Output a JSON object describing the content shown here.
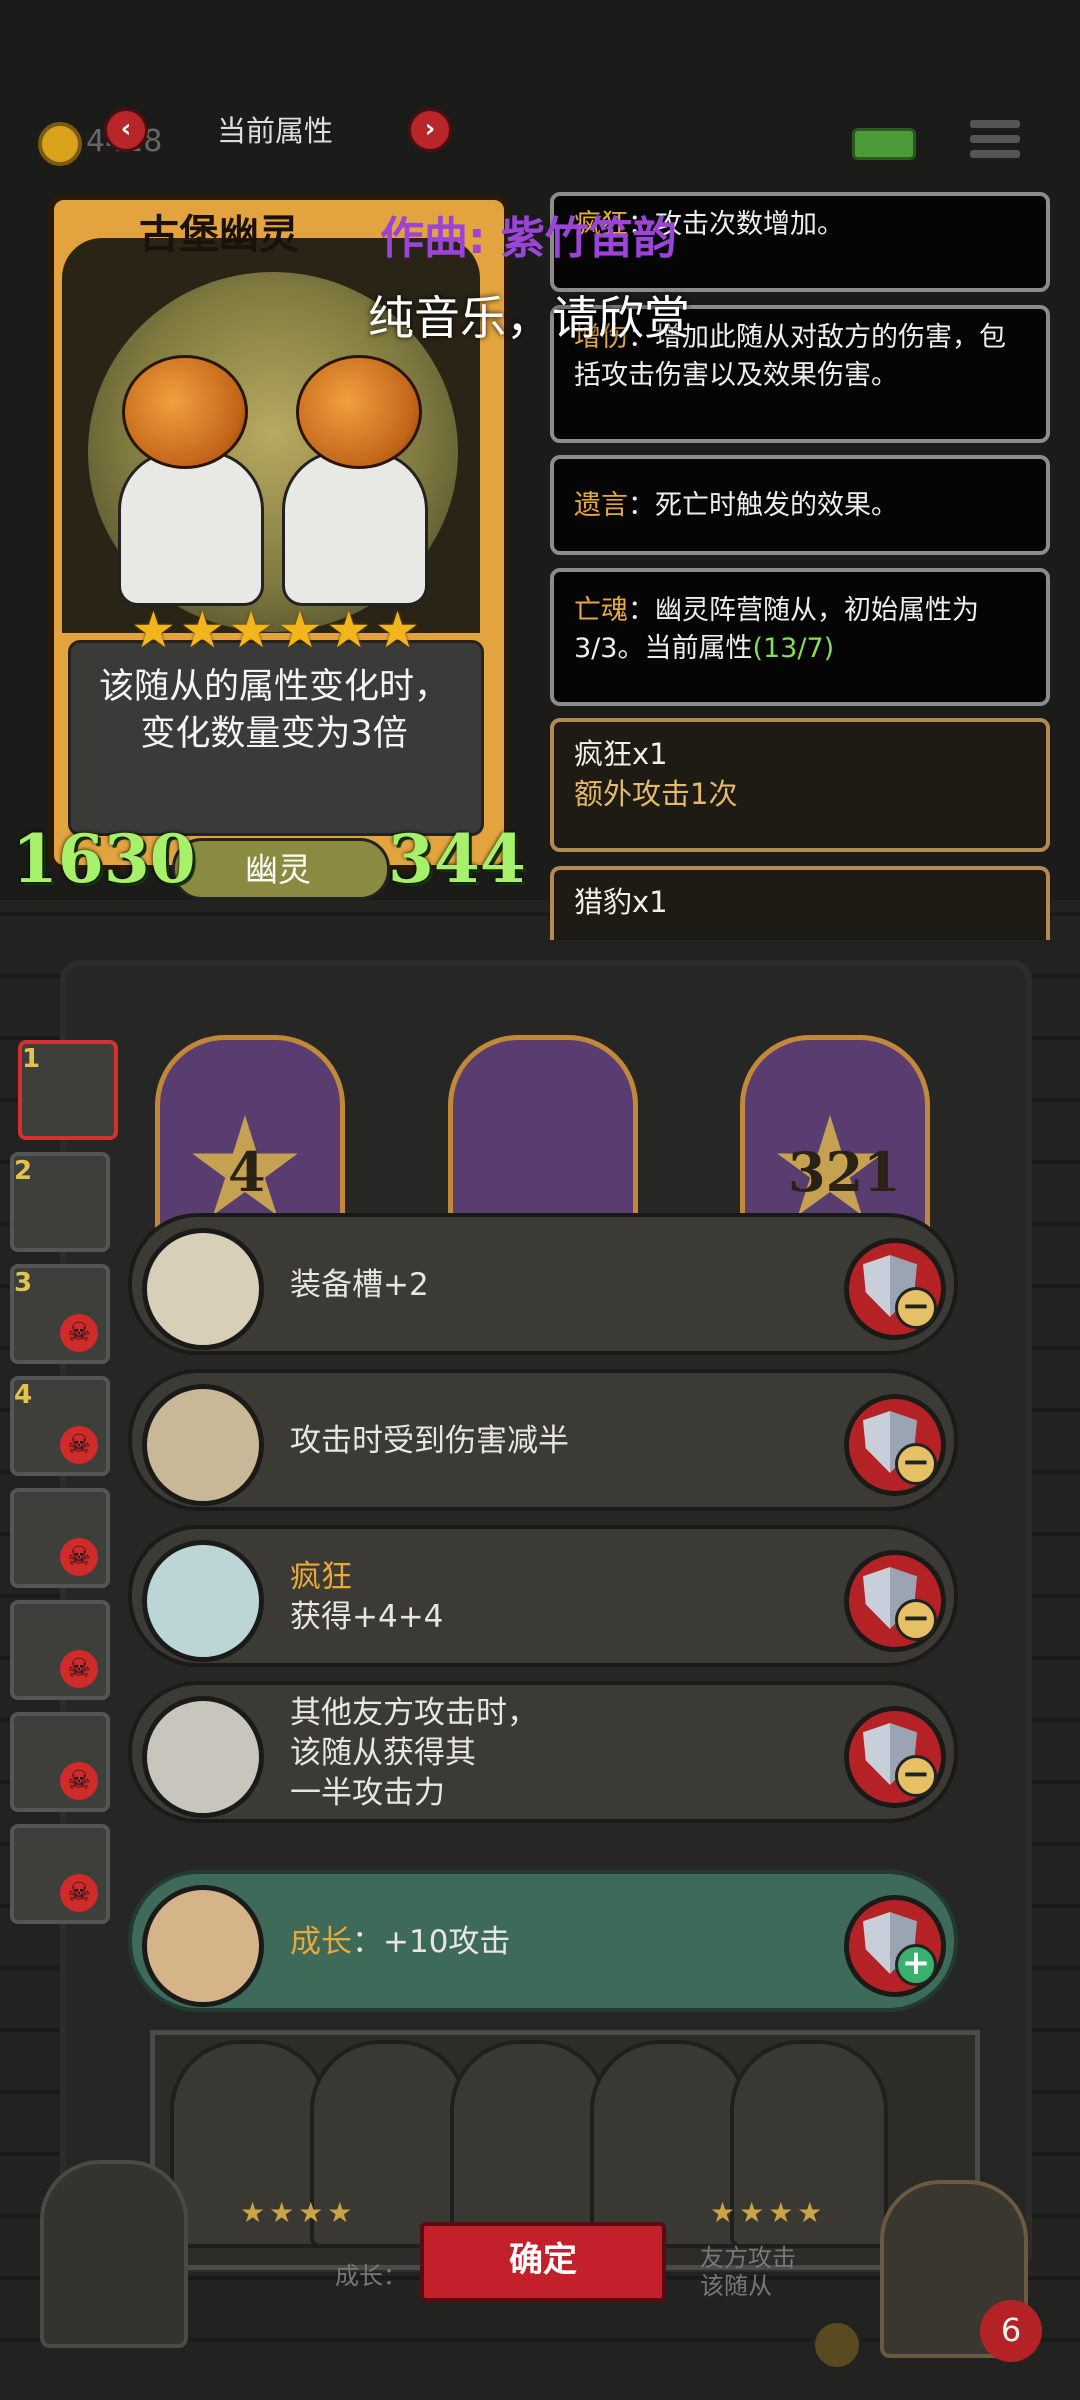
{
  "topbar": {
    "coin_value": "4418",
    "title": "当前属性",
    "prev_icon": "chevron-left-icon",
    "next_icon": "chevron-right-icon"
  },
  "overlay": {
    "composer": "作曲: 紫竹笛韵",
    "subtitle": "纯音乐，请欣赏"
  },
  "card": {
    "name": "古堡幽灵",
    "stars": "★★★★★★",
    "star_count": 6,
    "ability": "该随从的属性变化时，变化数量变为3倍",
    "attack": "1630",
    "health": "344",
    "type": "幽灵"
  },
  "info_panels": [
    {
      "keyword": "疯狂",
      "text": "：攻击次数增加。"
    },
    {
      "keyword": "增伤",
      "text": "：增加此随从对敌方的伤害，包括攻击伤害以及效果伤害。"
    },
    {
      "keyword": "遗言",
      "text": "：死亡时触发的效果。"
    },
    {
      "keyword": "亡魂",
      "text": "：幽灵阵营随从，初始属性为3/3。当前属性",
      "highlight": "(13/7)"
    }
  ],
  "buffs": [
    {
      "title": "疯狂x1",
      "desc": "额外攻击1次"
    },
    {
      "title": "猎豹x1",
      "desc": ""
    }
  ],
  "minion_slots": [
    "1",
    "2",
    "3",
    "4",
    "",
    "",
    "",
    ""
  ],
  "top_cards": [
    "4",
    "",
    "321"
  ],
  "equipment": [
    {
      "keyword": "",
      "text": "装备槽+2",
      "icon": "pig-icon",
      "action": "remove"
    },
    {
      "keyword": "",
      "text": "攻击时受到伤害减半",
      "icon": "crossbow-icon",
      "action": "remove"
    },
    {
      "keyword": "疯狂",
      "text": "获得+4+4",
      "icon": "lightning-crystal-icon",
      "action": "remove"
    },
    {
      "keyword": "",
      "text": "其他友方攻击时，\n该随从获得其\n一半攻击力",
      "icon": "trident-icon",
      "action": "remove"
    },
    {
      "keyword": "成长",
      "text": "：+10攻击",
      "icon": "axe-icon",
      "action": "add"
    }
  ],
  "bottom": {
    "confirm_label": "确定",
    "growth_label": "成长：",
    "ally_label": "友方攻击\n该随从",
    "hp": "6"
  }
}
